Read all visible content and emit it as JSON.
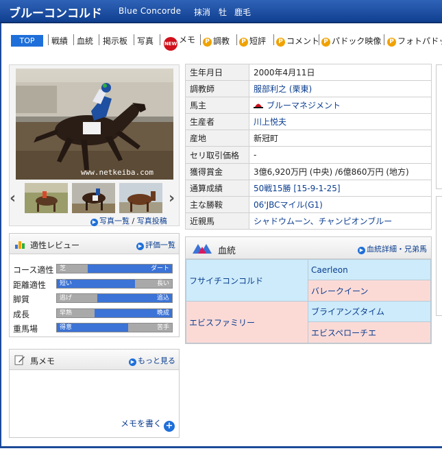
{
  "header": {
    "name": "ブルーコンコルド",
    "name_en": "Blue Concorde",
    "status": "抹消",
    "sex": "牡",
    "color": "鹿毛"
  },
  "nav": {
    "top": "TOP",
    "items": [
      "戦績",
      "血統",
      "掲示板",
      "写真"
    ],
    "new_badge": "NEW",
    "memo": "メモ",
    "premium_badge": "P",
    "premium_items": [
      "調教",
      "短評",
      "コメント",
      "パドック映像",
      "フォトパドック"
    ]
  },
  "photo": {
    "watermark": "www.netkeiba.com",
    "link_list": "写真一覧",
    "link_sep": "/",
    "link_post": "写真投稿"
  },
  "aptitude": {
    "title": "適性レビュー",
    "link": "評価一覧",
    "rows": [
      {
        "label": "コース適性",
        "left": "芝",
        "right": "ダート",
        "fill_from": 0.27,
        "fill_to": 1.0
      },
      {
        "label": "距離適性",
        "left": "短い",
        "right": "長い",
        "fill_from": 0.0,
        "fill_to": 0.68
      },
      {
        "label": "脚質",
        "left": "逃げ",
        "right": "追込",
        "fill_from": 0.35,
        "fill_to": 1.0
      },
      {
        "label": "成長",
        "left": "早熟",
        "right": "晩成",
        "fill_from": 0.33,
        "fill_to": 1.0
      },
      {
        "label": "重馬場",
        "left": "得意",
        "right": "苦手",
        "fill_from": 0.0,
        "fill_to": 0.62
      }
    ]
  },
  "memo": {
    "title": "馬メモ",
    "link": "もっと見る",
    "write": "メモを書く"
  },
  "profile": [
    {
      "key": "生年月日",
      "value": "2000年4月11日",
      "link": false
    },
    {
      "key": "調教師",
      "value": "服部利之 (栗東)",
      "link": true
    },
    {
      "key": "馬主",
      "value": "ブルーマネジメント",
      "link": true,
      "hat": true
    },
    {
      "key": "生産者",
      "value": "川上悦夫",
      "link": true
    },
    {
      "key": "産地",
      "value": "新冠町",
      "link": false
    },
    {
      "key": "セリ取引価格",
      "value": "-",
      "link": false
    },
    {
      "key": "獲得賞金",
      "value": "3億6,920万円 (中央) /6億860万円 (地方)",
      "link": false
    },
    {
      "key": "通算成績",
      "value": "50戦15勝 [15-9-1-25]",
      "link": true
    },
    {
      "key": "主な勝鞍",
      "value": "06'JBCマイル(G1)",
      "link": true
    },
    {
      "key": "近親馬",
      "value": "シャドウムーン、チャンピオンブルー",
      "link": true
    }
  ],
  "pedigree": {
    "title": "血統",
    "link": "血統詳細・兄弟馬",
    "sire": "フサイチコンコルド",
    "sire_sire": "Caerleon",
    "sire_dam": "バレークイーン",
    "dam": "エビスファミリー",
    "dam_sire": "ブライアンズタイム",
    "dam_dam": "エビスペローチエ"
  },
  "colors": {
    "header": "#1c4a99",
    "accent": "#1e6fd9",
    "sire_bg": "#cdebfa",
    "dam_bg": "#fbdad6"
  }
}
